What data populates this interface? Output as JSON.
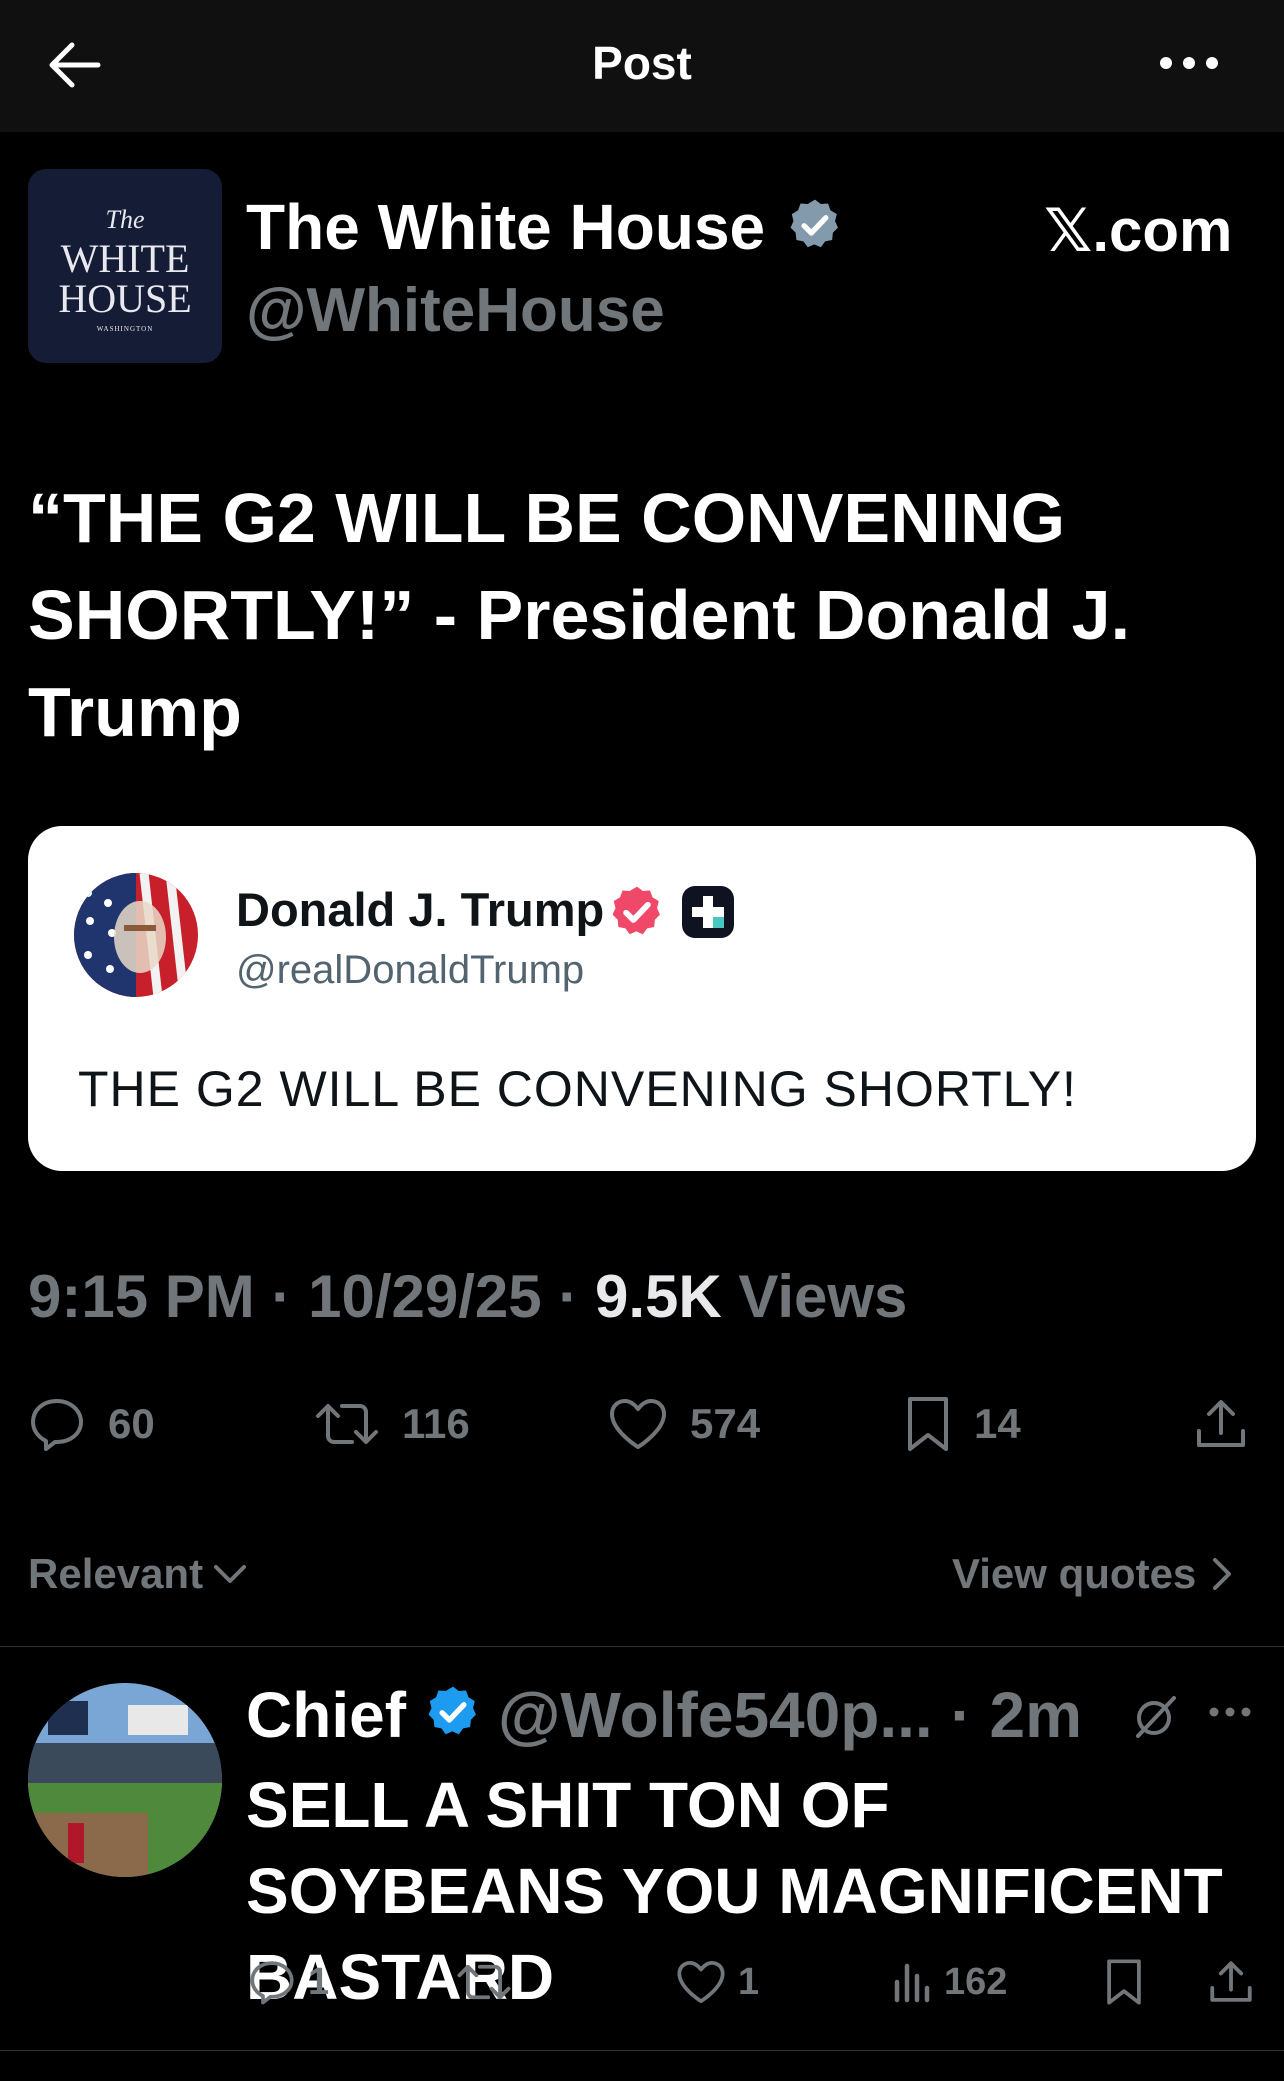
{
  "header": {
    "title": "Post",
    "back_icon": "arrow-left-icon",
    "more_icon": "more-horizontal-icon"
  },
  "post": {
    "author_name": "The White House",
    "author_handle": "@WhiteHouse",
    "brand": "𝕏.com",
    "avatar": {
      "line1": "The",
      "line2": "WHITE",
      "line3": "HOUSE",
      "line4": "WASHINGTON"
    },
    "text": "“THE G2 WILL BE CONVENING SHORTLY!” - President Donald J. Trump",
    "quote": {
      "author_name": "Donald J. Trump",
      "author_handle": "@realDonaldTrump",
      "text": "THE G2 WILL BE CONVENING SHORTLY!"
    },
    "time": "9:15 PM",
    "sep1": " · ",
    "date": "10/29/25",
    "sep2": " · ",
    "views_count": "9.5K",
    "views_label": " Views",
    "stats": {
      "replies": "60",
      "reposts": "116",
      "likes": "574",
      "bookmarks": "14"
    }
  },
  "replies_bar": {
    "sort_label": "Relevant",
    "view_quotes_label": "View quotes"
  },
  "reply": {
    "author_name": "Chief",
    "author_handle": "@Wolfe540p... · 2m",
    "text": "SELL A SHIT TON OF SOYBEANS YOU MAGNIFICENT BASTARD",
    "stats": {
      "replies": "1",
      "likes": "1",
      "views": "162"
    }
  },
  "colors": {
    "background": "#000000",
    "verified_blue": "#1d9bf0",
    "verified_gray": "#829aab",
    "muted": "#71767b",
    "truth_badge": "#f04868"
  }
}
